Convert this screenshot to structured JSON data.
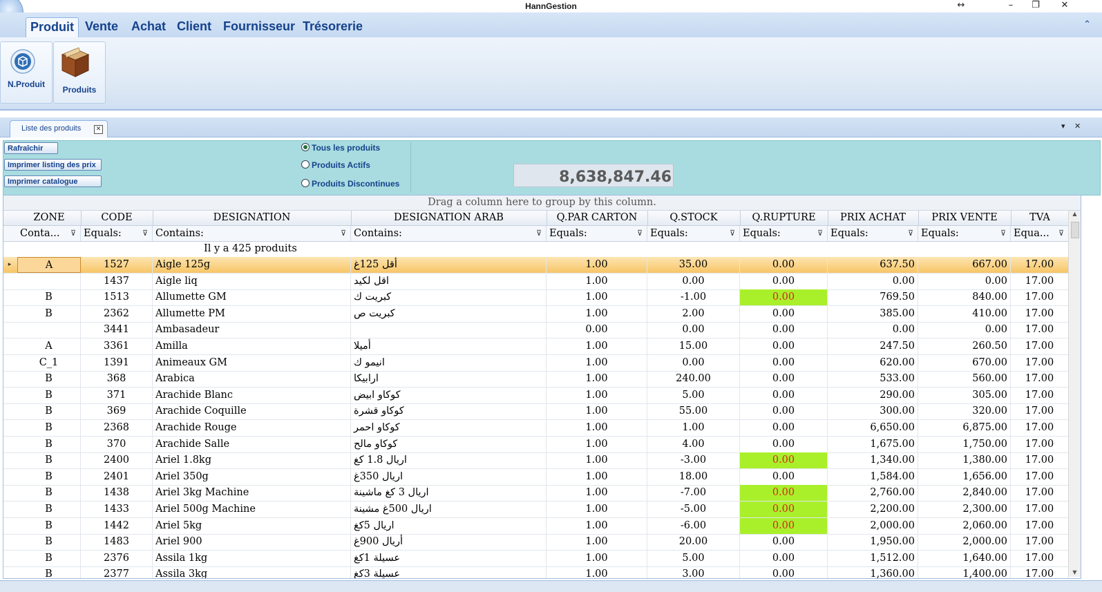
{
  "window": {
    "title": "HannGestion"
  },
  "ribbon": {
    "tabs": [
      "Produit",
      "Vente",
      "Achat",
      "Client",
      "Fournisseur",
      "Trésorerie"
    ],
    "active_tab": "Produit",
    "buttons": [
      {
        "label": "N.Produit",
        "icon": "new-product-icon"
      },
      {
        "label": "Produits",
        "icon": "products-box-icon"
      }
    ]
  },
  "doc_tab": {
    "label": "Liste des produits"
  },
  "toolbar": {
    "refresh": "Rafraîchir",
    "print_prices": "Imprimer listing des prix",
    "print_catalog": "Imprimer catalogue",
    "radios": [
      {
        "label": "Tous les produits",
        "checked": true
      },
      {
        "label": "Produits Actifs",
        "checked": false
      },
      {
        "label": "Produits Discontinues",
        "checked": false
      }
    ],
    "total": "8,638,847.46"
  },
  "grid": {
    "group_panel": "Drag a column here to group by this column.",
    "columns": [
      "ZONE",
      "CODE",
      "DESIGNATION",
      "DESIGNATION ARAB",
      "Q.PAR CARTON",
      "Q.STOCK",
      "Q.RUPTURE",
      "PRIX ACHAT",
      "PRIX VENTE",
      "TVA"
    ],
    "filters": [
      "Conta...",
      "Equals:",
      "Contains:",
      "Contains:",
      "Equals:",
      "Equals:",
      "Equals:",
      "Equals:",
      "Equals:",
      "Equa..."
    ],
    "count_text": "Il y a  425 produits",
    "alert_color": "#a9f02b",
    "selected_color": "#f7c566",
    "rows": [
      {
        "zone": "A",
        "code": "1527",
        "designation": "Aigle 125g",
        "arab": "أقل 125غ",
        "qcarton": "1.00",
        "qstock": "35.00",
        "qrupture": "0.00",
        "achat": "637.50",
        "vente": "667.00",
        "tva": "17.00",
        "selected": true
      },
      {
        "zone": "",
        "code": "1437",
        "designation": "Aigle liq",
        "arab": "اقل لكيد",
        "qcarton": "1.00",
        "qstock": "0.00",
        "qrupture": "0.00",
        "achat": "0.00",
        "vente": "0.00",
        "tva": "17.00"
      },
      {
        "zone": "B",
        "code": "1513",
        "designation": "Allumette GM",
        "arab": "كبريت ك",
        "qcarton": "1.00",
        "qstock": "-1.00",
        "qrupture": "0.00",
        "achat": "769.50",
        "vente": "840.00",
        "tva": "17.00",
        "alert": true
      },
      {
        "zone": "B",
        "code": "2362",
        "designation": "Allumette PM",
        "arab": "كبريت ص",
        "qcarton": "1.00",
        "qstock": "2.00",
        "qrupture": "0.00",
        "achat": "385.00",
        "vente": "410.00",
        "tva": "17.00"
      },
      {
        "zone": "",
        "code": "3441",
        "designation": "Ambasadeur",
        "arab": "",
        "qcarton": "0.00",
        "qstock": "0.00",
        "qrupture": "0.00",
        "achat": "0.00",
        "vente": "0.00",
        "tva": "17.00"
      },
      {
        "zone": "A",
        "code": "3361",
        "designation": "Amilla",
        "arab": "أميلا",
        "qcarton": "1.00",
        "qstock": "15.00",
        "qrupture": "0.00",
        "achat": "247.50",
        "vente": "260.50",
        "tva": "17.00"
      },
      {
        "zone": "C_1",
        "code": "1391",
        "designation": "Animeaux GM",
        "arab": "انيمو ك",
        "qcarton": "1.00",
        "qstock": "0.00",
        "qrupture": "0.00",
        "achat": "620.00",
        "vente": "670.00",
        "tva": "17.00"
      },
      {
        "zone": "B",
        "code": "368",
        "designation": "Arabica",
        "arab": "ارابيكا",
        "qcarton": "1.00",
        "qstock": "240.00",
        "qrupture": "0.00",
        "achat": "533.00",
        "vente": "560.00",
        "tva": "17.00"
      },
      {
        "zone": "B",
        "code": "371",
        "designation": "Arachide Blanc",
        "arab": "كوكاو ابيض",
        "qcarton": "1.00",
        "qstock": "5.00",
        "qrupture": "0.00",
        "achat": "290.00",
        "vente": "305.00",
        "tva": "17.00"
      },
      {
        "zone": "B",
        "code": "369",
        "designation": "Arachide Coquille",
        "arab": "كوكاو قشرة",
        "qcarton": "1.00",
        "qstock": "55.00",
        "qrupture": "0.00",
        "achat": "300.00",
        "vente": "320.00",
        "tva": "17.00"
      },
      {
        "zone": "B",
        "code": "2368",
        "designation": "Arachide Rouge",
        "arab": "كوكاو احمر",
        "qcarton": "1.00",
        "qstock": "1.00",
        "qrupture": "0.00",
        "achat": "6,650.00",
        "vente": "6,875.00",
        "tva": "17.00"
      },
      {
        "zone": "B",
        "code": "370",
        "designation": "Arachide Salle",
        "arab": "كوكاو مالح",
        "qcarton": "1.00",
        "qstock": "4.00",
        "qrupture": "0.00",
        "achat": "1,675.00",
        "vente": "1,750.00",
        "tva": "17.00"
      },
      {
        "zone": "B",
        "code": "2400",
        "designation": "Ariel 1.8kg",
        "arab": "اريال 1.8 كغ",
        "qcarton": "1.00",
        "qstock": "-3.00",
        "qrupture": "0.00",
        "achat": "1,340.00",
        "vente": "1,380.00",
        "tva": "17.00",
        "alert": true
      },
      {
        "zone": "B",
        "code": "2401",
        "designation": "Ariel 350g",
        "arab": "اريال 350غ",
        "qcarton": "1.00",
        "qstock": "18.00",
        "qrupture": "0.00",
        "achat": "1,584.00",
        "vente": "1,656.00",
        "tva": "17.00"
      },
      {
        "zone": "B",
        "code": "1438",
        "designation": "Ariel 3kg Machine",
        "arab": "اريال 3 كغ ماشينة",
        "qcarton": "1.00",
        "qstock": "-7.00",
        "qrupture": "0.00",
        "achat": "2,760.00",
        "vente": "2,840.00",
        "tva": "17.00",
        "alert": true
      },
      {
        "zone": "B",
        "code": "1433",
        "designation": "Ariel 500g Machine",
        "arab": "اريال 500غ مشينة",
        "qcarton": "1.00",
        "qstock": "-5.00",
        "qrupture": "0.00",
        "achat": "2,200.00",
        "vente": "2,300.00",
        "tva": "17.00",
        "alert": true
      },
      {
        "zone": "B",
        "code": "1442",
        "designation": "Ariel 5kg",
        "arab": "اريال 5كغ",
        "qcarton": "1.00",
        "qstock": "-6.00",
        "qrupture": "0.00",
        "achat": "2,000.00",
        "vente": "2,060.00",
        "tva": "17.00",
        "alert": true
      },
      {
        "zone": "B",
        "code": "1483",
        "designation": "Ariel 900",
        "arab": "أريال 900غ",
        "qcarton": "1.00",
        "qstock": "20.00",
        "qrupture": "0.00",
        "achat": "1,950.00",
        "vente": "2,000.00",
        "tva": "17.00"
      },
      {
        "zone": "B",
        "code": "2376",
        "designation": "Assila 1kg",
        "arab": "عسيلة 1كغ",
        "qcarton": "1.00",
        "qstock": "5.00",
        "qrupture": "0.00",
        "achat": "1,512.00",
        "vente": "1,640.00",
        "tva": "17.00"
      },
      {
        "zone": "B",
        "code": "2377",
        "designation": "Assila 3kg",
        "arab": "عسيلة 3كغ",
        "qcarton": "1.00",
        "qstock": "3.00",
        "qrupture": "0.00",
        "achat": "1,360.00",
        "vente": "1,400.00",
        "tva": "17.00"
      }
    ]
  }
}
